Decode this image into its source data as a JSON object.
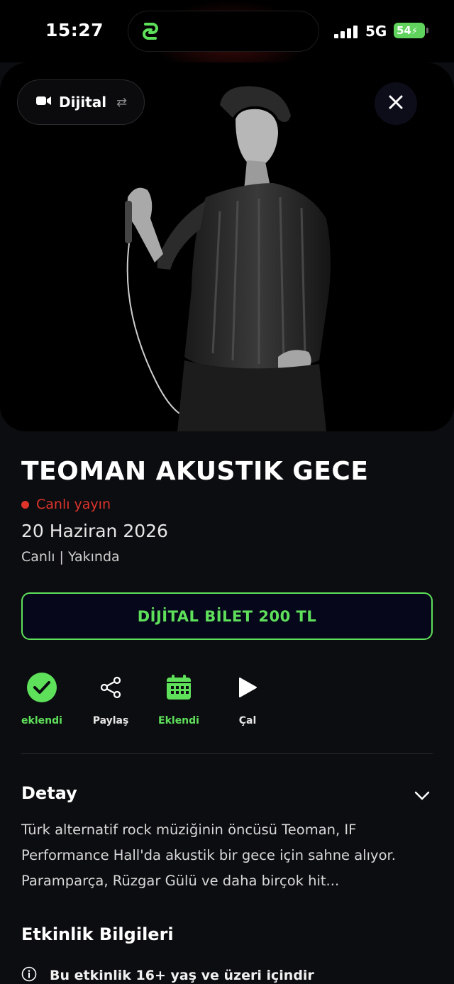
{
  "status_bar": {
    "time": "15:27",
    "network": "5G",
    "battery": "54"
  },
  "hero": {
    "mode_label": "Dijital",
    "image_icon": "performer-photo"
  },
  "event": {
    "title": "TEOMAN AKUSTIK GECE",
    "live_label": "Canlı yayın",
    "date": "20 Haziran 2026",
    "status": "Canlı | Yakında"
  },
  "ticket_button": "DİJİTAL BİLET 200 TL",
  "actions": [
    {
      "label": "eklendi",
      "icon": "check-circle-icon"
    },
    {
      "label": "Paylaş",
      "icon": "share-icon"
    },
    {
      "label": "Eklendi",
      "icon": "calendar-icon"
    },
    {
      "label": "Çal",
      "icon": "play-icon"
    }
  ],
  "detail": {
    "heading": "Detay",
    "text": "Türk alternatif rock müziğinin öncüsü Teoman, IF Performance Hall'da akustik bir gece için sahne alıyor. Paramparça, Rüzgar Gülü ve daha birçok hit..."
  },
  "info": {
    "heading": "Etkinlik Bilgileri",
    "age_notice": "Bu etkinlik 16+ yaş ve üzeri içindir"
  },
  "colors": {
    "accent": "#5ee05a",
    "live": "#e0342b",
    "background": "#0c0d10"
  }
}
